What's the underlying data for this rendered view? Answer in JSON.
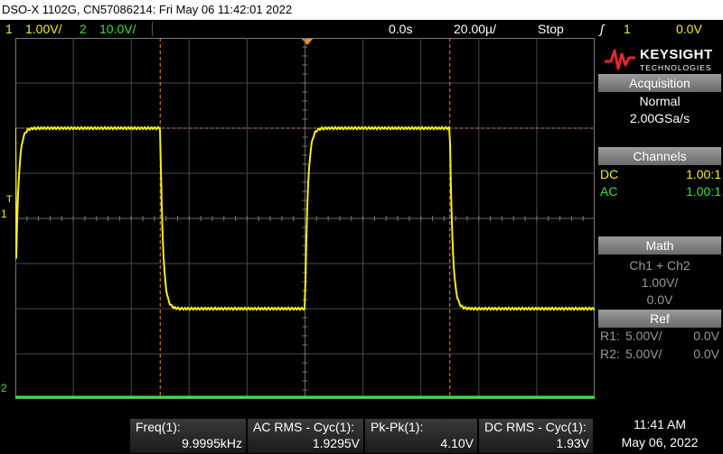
{
  "title_bar": "DSO-X 1102G, CN57086214: Fri May 06 11:42:01 2022",
  "status": {
    "ch1_num": "1",
    "ch1_scale": "1.00V/",
    "ch2_num": "2",
    "ch2_scale": "10.0V/",
    "time_offset": "0.0s",
    "time_scale": "20.00µ/",
    "run_state": "Stop",
    "trigger_icon": "ʃ",
    "trigger_channel": "1",
    "trigger_level": "0.0V"
  },
  "markers": {
    "trigger_level_marker": "T",
    "ch1_marker": "1",
    "ch2_marker": "2"
  },
  "brand": {
    "name": "KEYSIGHT",
    "sub": "TECHNOLOGIES",
    "logo_color": "#e5262b"
  },
  "acquisition": {
    "title": "Acquisition",
    "mode": "Normal",
    "rate": "2.00GSa/s"
  },
  "channels": {
    "title": "Channels",
    "rows": [
      {
        "coupling": "DC",
        "probe": "1.00:1"
      },
      {
        "coupling": "AC",
        "probe": "1.00:1"
      }
    ]
  },
  "math": {
    "title": "Math",
    "expr": "Ch1 + Ch2",
    "scale": "1.00V/",
    "offset": "0.0V"
  },
  "ref": {
    "title": "Ref",
    "rows": [
      {
        "name": "R1:",
        "scale": "5.00V/",
        "offset": "0.0V"
      },
      {
        "name": "R2:",
        "scale": "5.00V/",
        "offset": "0.0V"
      }
    ]
  },
  "measurements": [
    {
      "label": "Freq(1):",
      "value": "9.9995kHz"
    },
    {
      "label": "AC RMS - Cyc(1):",
      "value": "1.9295V"
    },
    {
      "label": "Pk-Pk(1):",
      "value": "4.10V"
    },
    {
      "label": "DC RMS - Cyc(1):",
      "value": "1.93V"
    }
  ],
  "clock": {
    "time": "11:41 AM",
    "date": "May 06, 2022"
  },
  "waveform": {
    "ch1_color": "#f5ee20",
    "ch2_color": "#3ee03e",
    "ch1_high_v": 2.0,
    "ch1_low_v": -2.0,
    "period_us": 100,
    "duty": 0.5
  }
}
